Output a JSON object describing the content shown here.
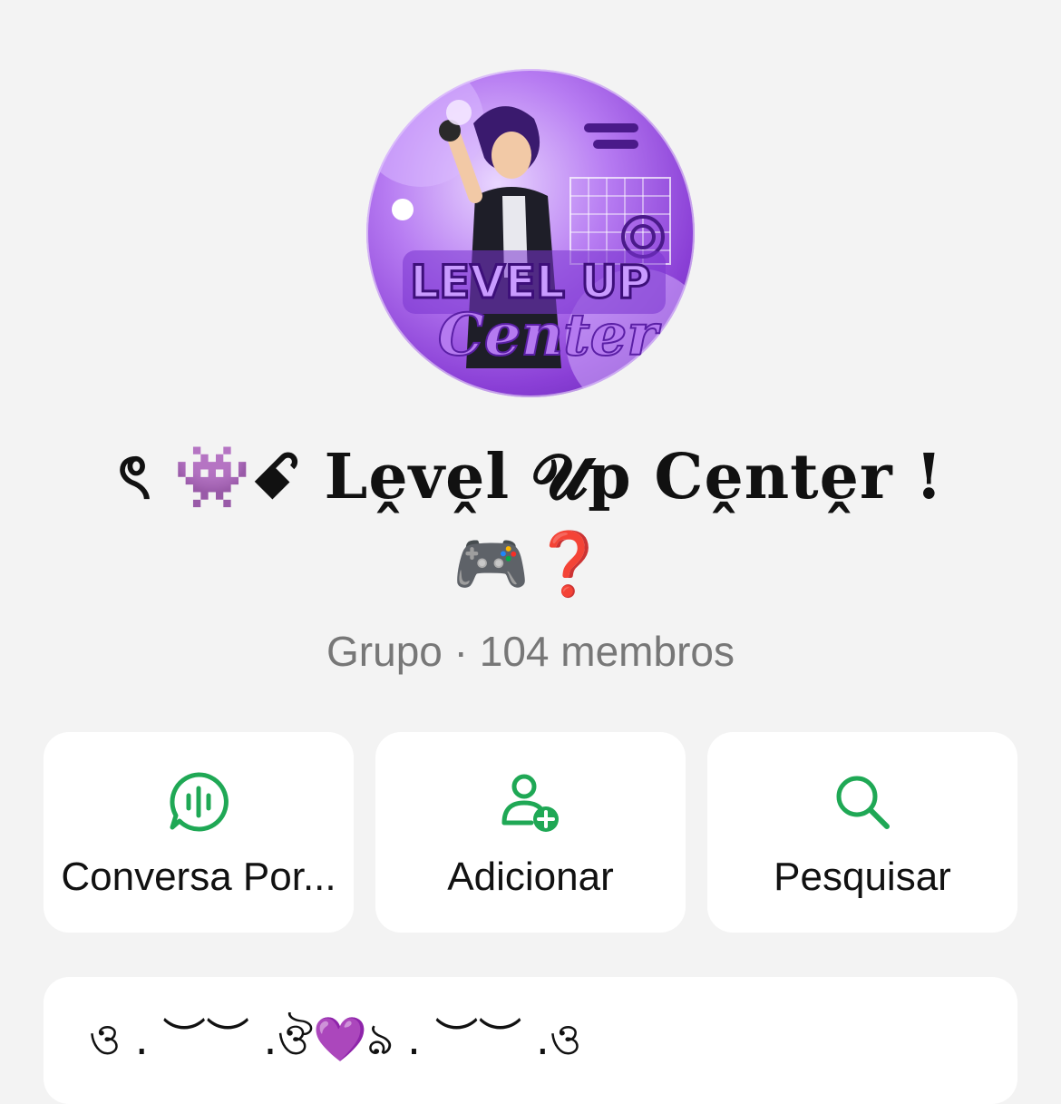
{
  "group": {
    "name_line1": "ৎ  👾ꗃ Lḙvḙl 𝓤p Cḙntḙr !",
    "name_line2": "🎮❓ ",
    "subtitle": "Grupo · 104 membros",
    "avatar_text_top": "LEVEL UP",
    "avatar_text_bottom": "Center"
  },
  "actions": [
    {
      "label": "Conversa Por...",
      "icon": "audio-chat-icon"
    },
    {
      "label": "Adicionar",
      "icon": "add-person-icon"
    },
    {
      "label": "Pesquisar",
      "icon": "search-icon"
    }
  ],
  "description": {
    "preview": "ও . ︶︶ .ঔ💜ঌ . ︶︶ .ও"
  },
  "colors": {
    "accent_green": "#1fa855",
    "background": "#f3f3f3",
    "card": "#ffffff",
    "subtitle_gray": "#777777"
  }
}
